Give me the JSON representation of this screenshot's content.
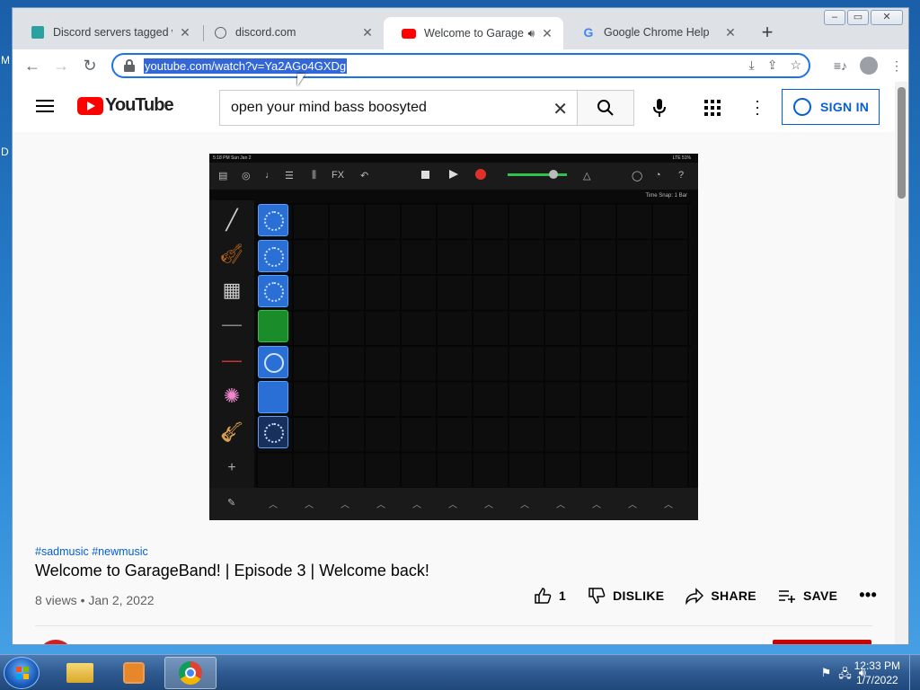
{
  "desktop": {
    "letters": [
      "M",
      "D"
    ]
  },
  "window": {
    "controls": [
      "minimize",
      "maximize",
      "close"
    ]
  },
  "tabs": [
    {
      "title": "Discord servers tagged w",
      "active": false
    },
    {
      "title": "discord.com",
      "active": false
    },
    {
      "title": "Welcome to GarageBa",
      "active": true
    },
    {
      "title": "Google Chrome Help",
      "active": false
    }
  ],
  "toolbar": {
    "url": "youtube.com/watch?v=Ya2AGo4GXDg"
  },
  "youtube": {
    "logo_text": "YouTube",
    "search_value": "open your mind bass boosyted",
    "sign_in": "SIGN IN"
  },
  "garageband": {
    "status_left": "5:18 PM  Sun Jan 2",
    "status_right": "LTE 51%",
    "time_snap": "Time Snap: 1 Bar",
    "fx": "FX"
  },
  "video": {
    "hashtags": "#sadmusic #newmusic",
    "title": "Welcome to GarageBand! | Episode 3 | Welcome back!",
    "meta": "8 views • Jan 2, 2022",
    "likes": "1",
    "dislike": "DISLIKE",
    "share": "SHARE",
    "save": "SAVE"
  },
  "taskbar": {
    "time": "12:33 PM",
    "date": "1/7/2022"
  }
}
